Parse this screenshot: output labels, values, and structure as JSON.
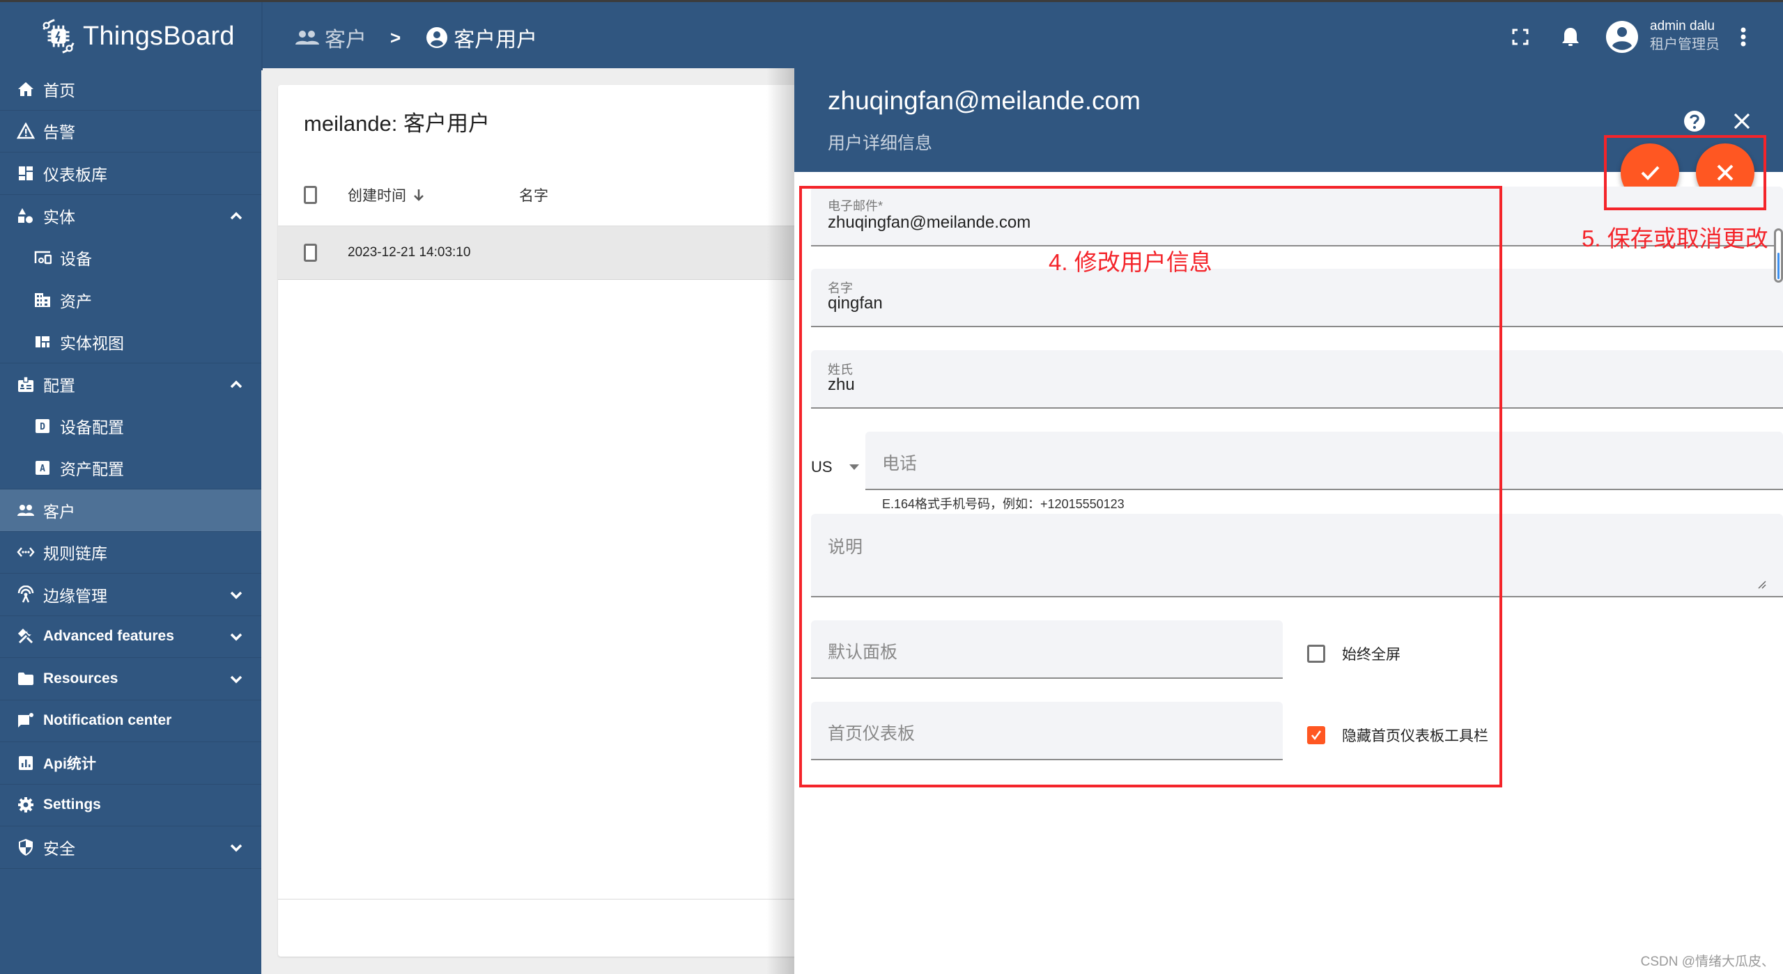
{
  "app": {
    "name": "ThingsBoard",
    "brand_color": "#305680",
    "accent_color": "#ff5722"
  },
  "topbar": {
    "breadcrumb": [
      {
        "label": "客户",
        "icon": "people-icon"
      },
      {
        "label": "客户用户",
        "icon": "account-circle-icon"
      }
    ],
    "breadcrumb_separator": ">",
    "user": {
      "name": "admin dalu",
      "role": "租户管理员"
    },
    "icons": [
      "fullscreen-icon",
      "bell-icon",
      "account-circle-icon",
      "more-vert-icon"
    ]
  },
  "sidebar": {
    "items": [
      {
        "label": "首页",
        "icon": "home-icon"
      },
      {
        "label": "告警",
        "icon": "warning-icon"
      },
      {
        "label": "仪表板库",
        "icon": "dashboard-icon"
      },
      {
        "label": "实体",
        "icon": "category-icon",
        "expanded": true,
        "children": [
          {
            "label": "设备",
            "icon": "devices-icon"
          },
          {
            "label": "资产",
            "icon": "domain-icon"
          },
          {
            "label": "实体视图",
            "icon": "view-quilt-icon"
          }
        ]
      },
      {
        "label": "配置",
        "icon": "badge-icon",
        "expanded": true,
        "children": [
          {
            "label": "设备配置",
            "icon": "device-profile-icon"
          },
          {
            "label": "资产配置",
            "icon": "asset-profile-icon"
          }
        ]
      },
      {
        "label": "客户",
        "icon": "people-icon",
        "active": true
      },
      {
        "label": "规则链库",
        "icon": "settings-ethernet-icon"
      },
      {
        "label": "边缘管理",
        "icon": "router-icon",
        "expanded": false
      },
      {
        "label": "Advanced features",
        "icon": "construction-icon",
        "expanded": false
      },
      {
        "label": "Resources",
        "icon": "folder-icon",
        "expanded": false
      },
      {
        "label": "Notification center",
        "icon": "mark-chat-unread-icon"
      },
      {
        "label": "Api统计",
        "icon": "insert-chart-icon"
      },
      {
        "label": "Settings",
        "icon": "settings-icon"
      },
      {
        "label": "安全",
        "icon": "security-icon",
        "expanded": false
      }
    ]
  },
  "list": {
    "title": "meilande: 客户用户",
    "columns": [
      {
        "label": "创建时间",
        "sort": "desc"
      },
      {
        "label": "名字"
      }
    ],
    "rows": [
      {
        "created": "2023-12-21 14:03:10",
        "name": ""
      }
    ]
  },
  "detail": {
    "title": "zhuqingfan@meilande.com",
    "subtitle": "用户详细信息",
    "fields": {
      "email": {
        "label": "电子邮件*",
        "value": "zhuqingfan@meilande.com"
      },
      "first_name": {
        "label": "名字",
        "value": "qingfan"
      },
      "last_name": {
        "label": "姓氏",
        "value": "zhu"
      },
      "country": {
        "value": "US"
      },
      "phone": {
        "placeholder": "电话",
        "value": "",
        "hint": "E.164格式手机号码，例如：+12015550123"
      },
      "description": {
        "placeholder": "说明",
        "value": ""
      },
      "default_dashboard": {
        "placeholder": "默认面板",
        "value": ""
      },
      "home_dashboard": {
        "placeholder": "首页仪表板",
        "value": ""
      }
    },
    "checkboxes": {
      "always_fullscreen": {
        "label": "始终全屏",
        "checked": false
      },
      "hide_home_toolbar": {
        "label": "隐藏首页仪表板工具栏",
        "checked": true
      }
    },
    "actions": {
      "save": "check-icon",
      "cancel": "close-icon"
    }
  },
  "annotations": {
    "form_note": "4. 修改用户信息",
    "actions_note": "5. 保存或取消更改",
    "color": "#f4242a"
  },
  "watermark": "CSDN @情绪大瓜皮、"
}
